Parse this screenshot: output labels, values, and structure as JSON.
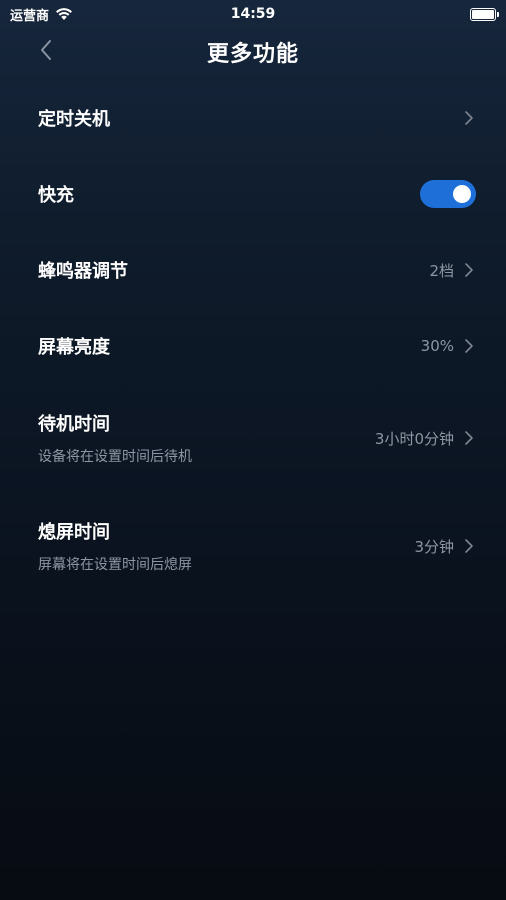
{
  "status_bar": {
    "carrier": "运营商",
    "time": "14:59"
  },
  "nav": {
    "title": "更多功能"
  },
  "settings": {
    "timer_off": {
      "label": "定时关机"
    },
    "fast_charge": {
      "label": "快充",
      "enabled": true
    },
    "buzzer": {
      "label": "蜂鸣器调节",
      "value": "2档"
    },
    "brightness": {
      "label": "屏幕亮度",
      "value": "30%"
    },
    "standby": {
      "label": "待机时间",
      "sub": "设备将在设置时间后待机",
      "value": "3小时0分钟"
    },
    "screen_off": {
      "label": "熄屏时间",
      "sub": "屏幕将在设置时间后熄屏",
      "value": "3分钟"
    }
  },
  "colors": {
    "accent": "#1f6fd8",
    "secondary_text": "#8d96a3"
  }
}
